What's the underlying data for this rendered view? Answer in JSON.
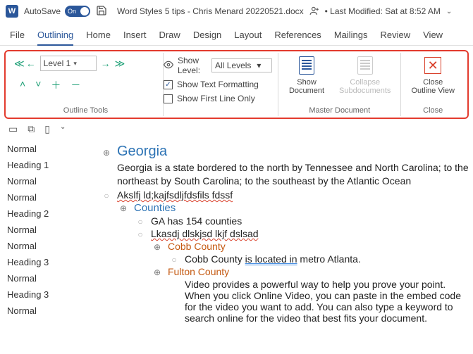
{
  "titlebar": {
    "autosave_label": "AutoSave",
    "autosave_on": "On",
    "doc_title": "Word Styles 5 tips - Chris Menard 20220521.docx",
    "last_modified": "• Last Modified: Sat at 8:52 AM"
  },
  "tabs": [
    "File",
    "Outlining",
    "Home",
    "Insert",
    "Draw",
    "Design",
    "Layout",
    "References",
    "Mailings",
    "Review",
    "View"
  ],
  "ribbon": {
    "outline_tools": {
      "level_value": "Level 1",
      "show_level_label": "Show Level:",
      "show_level_value": "All Levels",
      "show_text_formatting": "Show Text Formatting",
      "show_first_line": "Show First Line Only",
      "group_label": "Outline Tools"
    },
    "master": {
      "show_doc": "Show\nDocument",
      "collapse": "Collapse\nSubdocuments",
      "group_label": "Master Document"
    },
    "close": {
      "label": "Close\nOutline View",
      "group_label": "Close"
    }
  },
  "sidebar": [
    "Normal",
    "Heading 1",
    "Normal",
    "Normal",
    "Heading 2",
    "Normal",
    "Normal",
    "Heading 3",
    "Normal",
    "Heading 3",
    "Normal"
  ],
  "doc": {
    "l0_title": "Georgia",
    "l0_body": "Georgia is a state bordered to the north by Tennessee and North Carolina; to the northeast by South Carolina; to the southeast by the Atlantic Ocean",
    "l0_spell": "Akslfj ld;kajfsdljfdsfils fdssf",
    "l1_title": "Counties",
    "l1_body": "GA has 154 counties",
    "l1_spell": "Lkasdj dlskjsd lkjf dslsad",
    "l2_title_a": "Cobb County",
    "l2_body_a1": "Cobb County ",
    "l2_body_a2": "is located in",
    "l2_body_a3": " metro Atlanta.",
    "l2_title_b": "Fulton County",
    "l2_body_b": "Video provides a powerful way to help you prove your point. When you click Online Video, you can paste in the embed code for the video you want to add. You can also type a keyword to search online for the video that best fits your document."
  }
}
